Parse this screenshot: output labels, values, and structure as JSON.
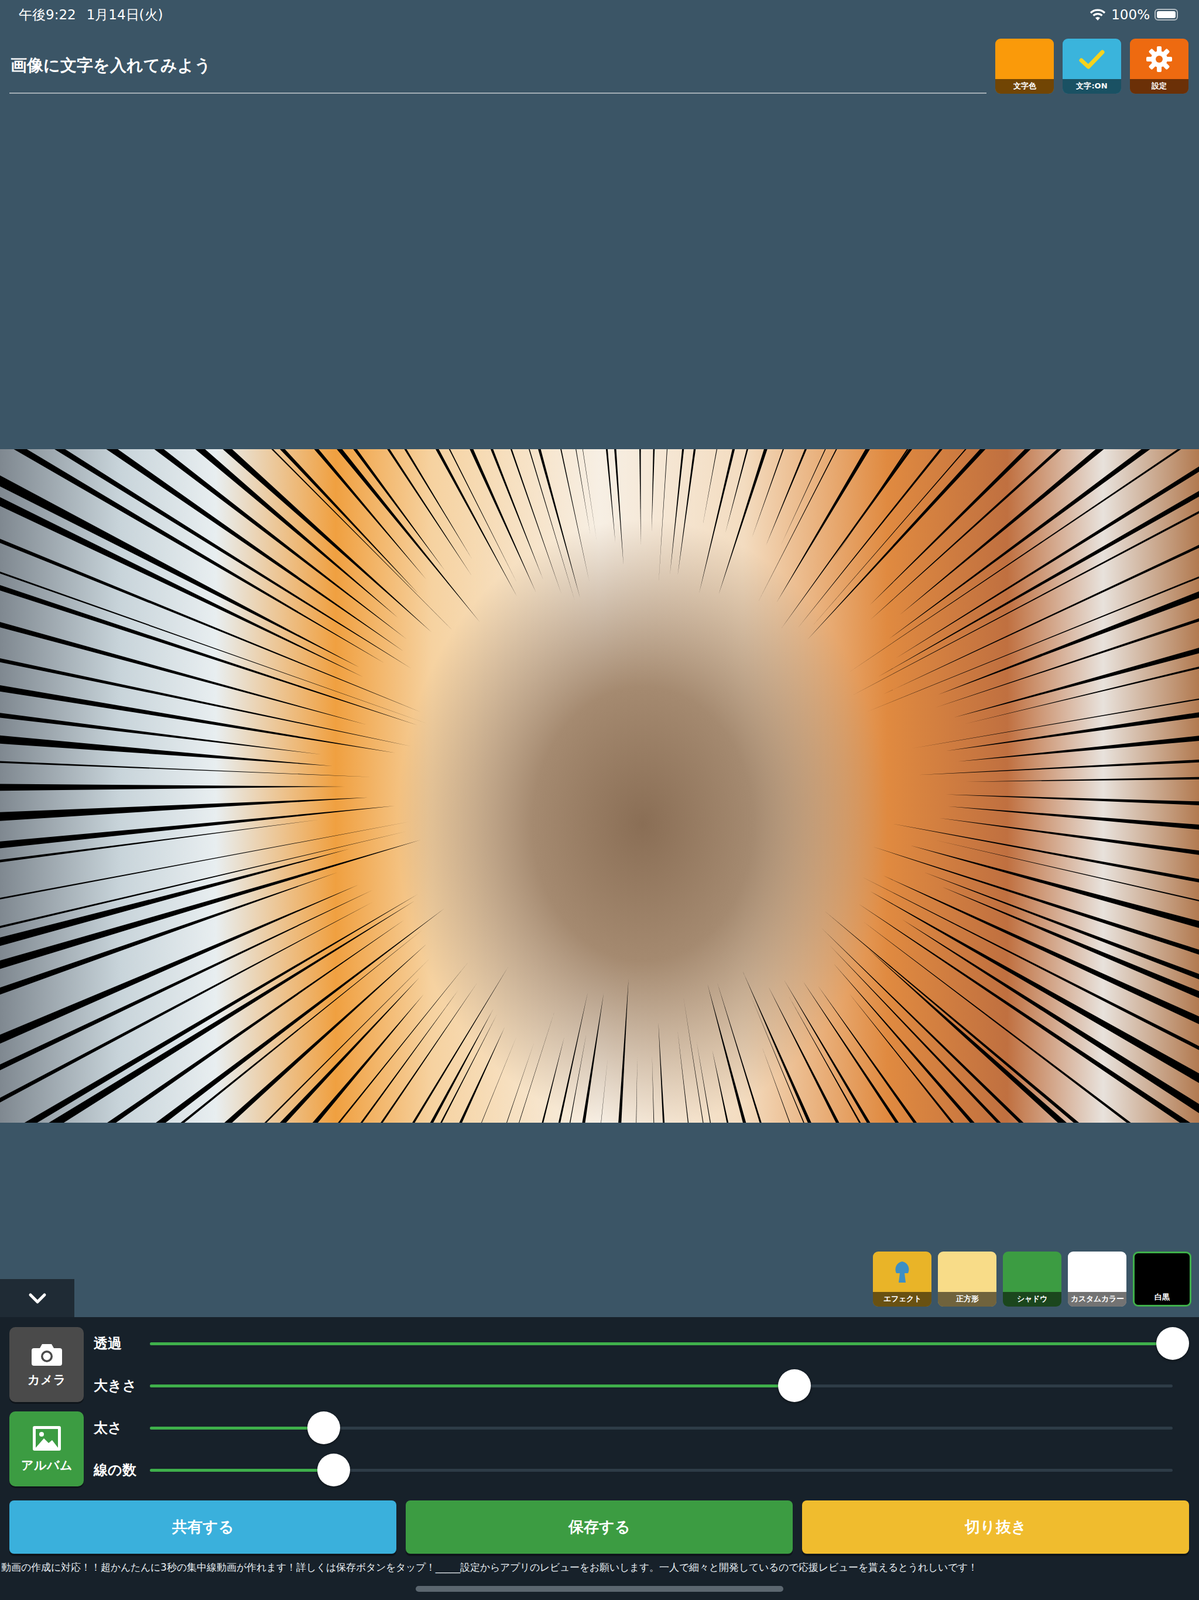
{
  "status_bar": {
    "time": "午後9:22",
    "date": "1月14日(火)",
    "battery": "100%",
    "battery_level": 1
  },
  "text_field": {
    "value": "画像に文字を入れてみよう"
  },
  "top_buttons": [
    {
      "label": "文字色",
      "kind": "color",
      "color": "#fa9a0a"
    },
    {
      "label": "文字:ON",
      "kind": "toggle",
      "color": "#3ab4dc"
    },
    {
      "label": "設定",
      "kind": "settings",
      "color": "#ee6a10"
    }
  ],
  "effect_buttons": [
    {
      "label": "エフェクト",
      "kind": "effect",
      "color": "#e9b428",
      "selected": false
    },
    {
      "label": "正方形",
      "kind": "plain",
      "color": "#f8dc88",
      "selected": false
    },
    {
      "label": "シャドウ",
      "kind": "plain",
      "color": "#3c9c42",
      "selected": false
    },
    {
      "label": "カスタムカラー",
      "kind": "plain",
      "color": "#ffffff",
      "selected": false
    },
    {
      "label": "白黒",
      "kind": "plain",
      "color": "#000000",
      "selected": true
    }
  ],
  "side_buttons": [
    {
      "label": "カメラ",
      "kind": "camera",
      "color": "#4a4a4a"
    },
    {
      "label": "アルバム",
      "kind": "album",
      "color": "#3c9c42"
    }
  ],
  "sliders": [
    {
      "label": "透過",
      "level": 1
    },
    {
      "label": "大きさ",
      "level": 0.63
    },
    {
      "label": "太さ",
      "level": 0.17
    },
    {
      "label": "線の数",
      "level": 0.18
    }
  ],
  "action_buttons": [
    {
      "label": "共有する",
      "color": "#3ab0dc"
    },
    {
      "label": "保存する",
      "color": "#3c9c42"
    },
    {
      "label": "切り抜き",
      "color": "#f0bc2e"
    }
  ],
  "marquee": "動画の作成に対応！！超かんたんに3秒の集中線動画が作れます！詳しくは保存ボタンをタップ！_____設定からアプリのレビューをお願いします。一人で細々と開発しているので応援レビューを貰えるとうれしいです！"
}
